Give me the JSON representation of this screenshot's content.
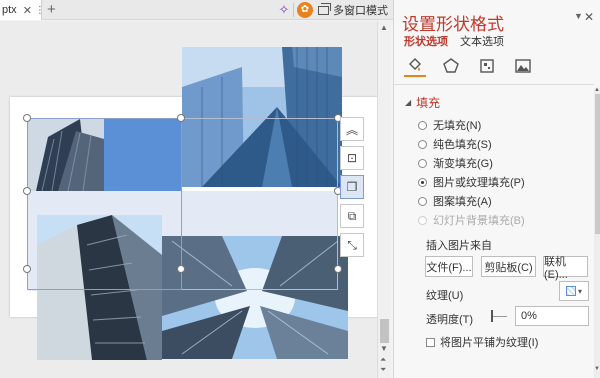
{
  "tab": {
    "label": "ptx",
    "close_icon": "close-icon",
    "menu_icon": "chevron-down-icon"
  },
  "new_tab_icon": "plus-icon",
  "toolbar": {
    "multi_window_label": "多窗口模式"
  },
  "pane": {
    "title": "设置形状格式",
    "tabs": {
      "shape_options": "形状选项",
      "text_options": "文本选项"
    },
    "icons": [
      "fill-line-icon",
      "effects-icon",
      "size-properties-icon",
      "picture-icon"
    ],
    "section_fill": "填充",
    "fill_options": [
      {
        "label": "无填充(N)",
        "checked": false,
        "disabled": false
      },
      {
        "label": "纯色填充(S)",
        "checked": false,
        "disabled": false
      },
      {
        "label": "渐变填充(G)",
        "checked": false,
        "disabled": false
      },
      {
        "label": "图片或纹理填充(P)",
        "checked": true,
        "disabled": false
      },
      {
        "label": "图案填充(A)",
        "checked": false,
        "disabled": false
      },
      {
        "label": "幻灯片背景填充(B)",
        "checked": false,
        "disabled": true
      }
    ],
    "insert_from": "插入图片来自",
    "buttons": {
      "file": "文件(F)...",
      "clipboard": "剪贴板(C)",
      "online": "联机(E)..."
    },
    "texture_label": "纹理(U)",
    "transparency_label": "透明度(T)",
    "transparency_value": "0%",
    "tile_label": "将图片平铺为纹理(I)"
  },
  "colors": {
    "accent_red": "#c0392b",
    "accent_orange": "#e8821d",
    "shape_blue": "#5b8fd6"
  }
}
